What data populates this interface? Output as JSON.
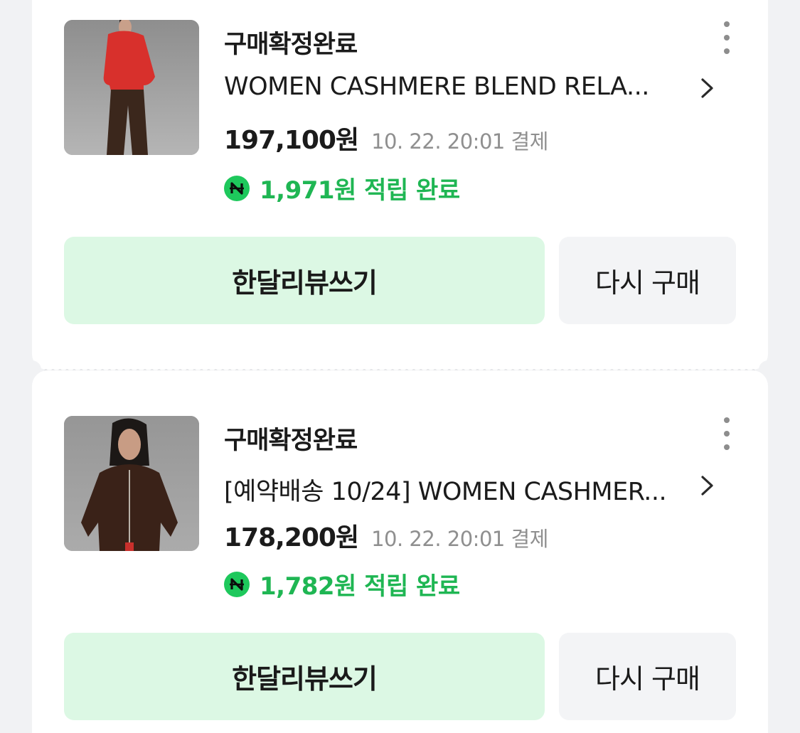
{
  "orders": [
    {
      "status": "구매확정완료",
      "title": "WOMEN CASHMERE BLEND RELA...",
      "price": "197,100원",
      "pay_date": "10. 22. 20:01 결제",
      "reward": "1,971원 적립 완료",
      "review_label": "한달리뷰쓰기",
      "rebuy_label": "다시 구매",
      "thumb_icon": "product-photo-red-sweater"
    },
    {
      "status": "구매확정완료",
      "title": "[예약배송 10/24] WOMEN CASHMER...",
      "price": "178,200원",
      "pay_date": "10. 22. 20:01 결제",
      "reward": "1,782원 적립 완료",
      "review_label": "한달리뷰쓰기",
      "rebuy_label": "다시 구매",
      "thumb_icon": "product-photo-brown-hoodie"
    }
  ],
  "icons": {
    "more": "kebab-menu-icon",
    "chevron": "chevron-right-icon",
    "reward": "naver-pay-n-icon"
  },
  "colors": {
    "reward_green": "#1fb653",
    "review_button_bg": "#dcf8e4",
    "rebuy_button_bg": "#f3f4f6",
    "page_bg": "#f1f2f4"
  }
}
